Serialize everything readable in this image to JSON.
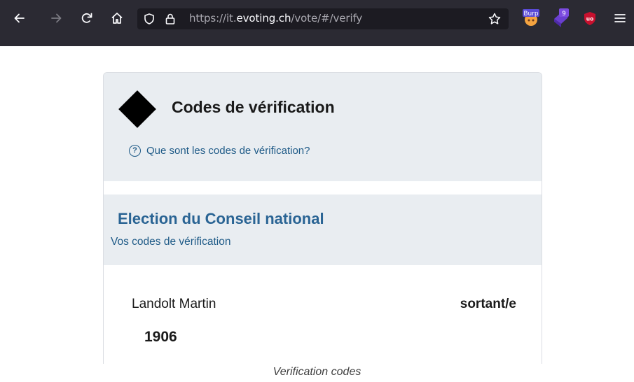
{
  "browser": {
    "url_prefix": "https://it.",
    "url_host": "evoting.ch",
    "url_path": "/vote/#/verify",
    "extensions": [
      {
        "name": "burp-extension-icon",
        "label": "Burp"
      },
      {
        "name": "counter-extension-icon",
        "badge": "9"
      },
      {
        "name": "ublock-origin-icon",
        "label": "uo"
      }
    ]
  },
  "page": {
    "title": "Codes de vérification",
    "help_link": "Que sont les codes de vérification?",
    "help_icon": "?",
    "section": {
      "title": "Election du Conseil national",
      "subtitle": "Vos codes de vérification"
    },
    "candidate": {
      "name": "Landolt Martin",
      "status": "sortant/e",
      "code": "1906"
    }
  },
  "caption": "Verification codes",
  "colors": {
    "toolbar_bg": "#2b2a33",
    "urlbar_bg": "#1c1b22",
    "panel_bg": "#e9edf1",
    "link_blue": "#1e5a87",
    "heading_blue": "#2a6494"
  }
}
